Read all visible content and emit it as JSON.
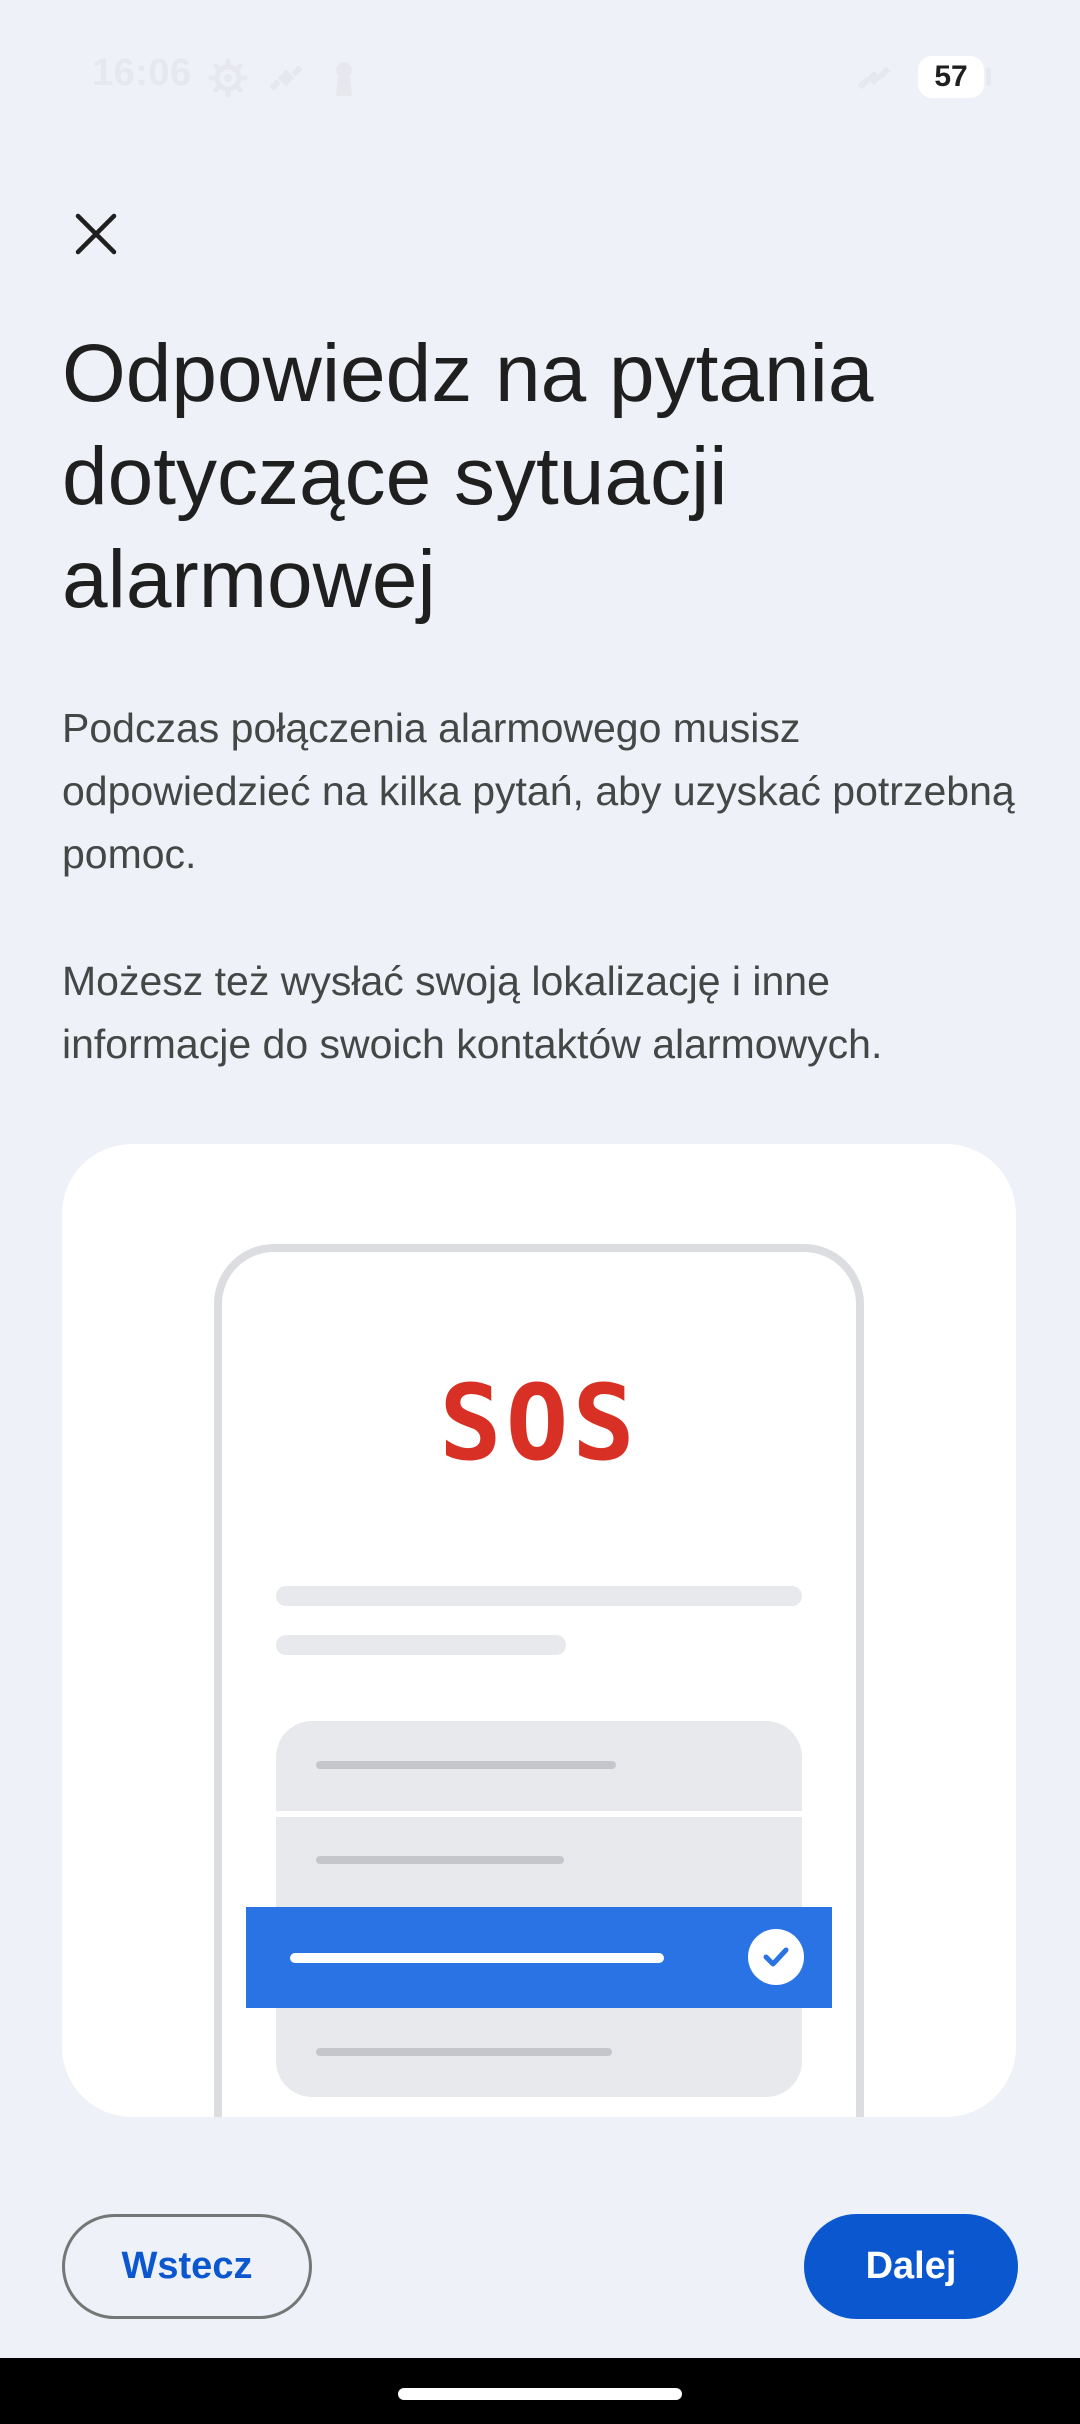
{
  "status_bar": {
    "time": "16:06",
    "battery": "57",
    "icons": [
      "settings-gear-icon",
      "satellite-icon",
      "keyhole-icon",
      "satellite-signal-icon"
    ]
  },
  "header": {
    "close_icon": "close-icon"
  },
  "main": {
    "title": "Odpowiedz na pytania dotyczące sytuacji alarmowej",
    "paragraph_1": "Podczas połączenia alarmowego musisz odpowiedzieć na kilka pytań, aby uzyskać potrzebną pomoc.",
    "paragraph_2": "Możesz też wysłać swoją lokalizację i inne informacje do swoich kontaktów alarmowych."
  },
  "illustration": {
    "sos_text": "SOS",
    "sos_color": "#d93025",
    "selected_color": "#2a73e4"
  },
  "footer": {
    "back_label": "Wstecz",
    "next_label": "Dalej",
    "accent_color": "#0b57d0"
  }
}
